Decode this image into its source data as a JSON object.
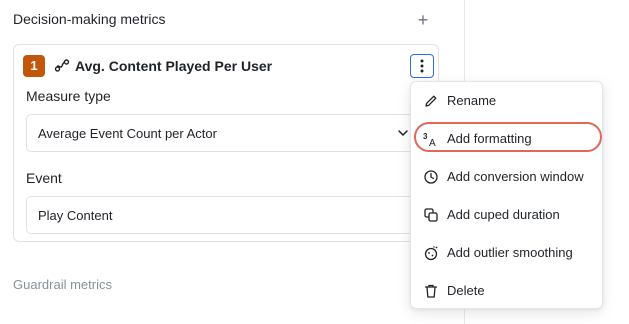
{
  "section": {
    "title": "Decision-making metrics",
    "add_symbol": "+"
  },
  "metric": {
    "index": "1",
    "name": "Avg. Content Played Per User",
    "measure_type_label": "Measure type",
    "measure_type_value": "Average Event Count per Actor",
    "event_label": "Event",
    "event_value": "Play Content"
  },
  "guardrail_title": "Guardrail metrics",
  "menu": {
    "items": [
      {
        "label": "Rename",
        "icon": "pencil-icon"
      },
      {
        "label": "Add formatting",
        "icon": "formatting-icon",
        "highlighted": true
      },
      {
        "label": "Add conversion window",
        "icon": "clock-icon"
      },
      {
        "label": "Add cuped duration",
        "icon": "copy-icon"
      },
      {
        "label": "Add outlier smoothing",
        "icon": "smoothing-icon"
      },
      {
        "label": "Delete",
        "icon": "trash-icon"
      }
    ]
  },
  "colors": {
    "badge": "#c2570c",
    "focus_blue": "#2f6fdd",
    "highlight_ring": "#e0685a"
  }
}
